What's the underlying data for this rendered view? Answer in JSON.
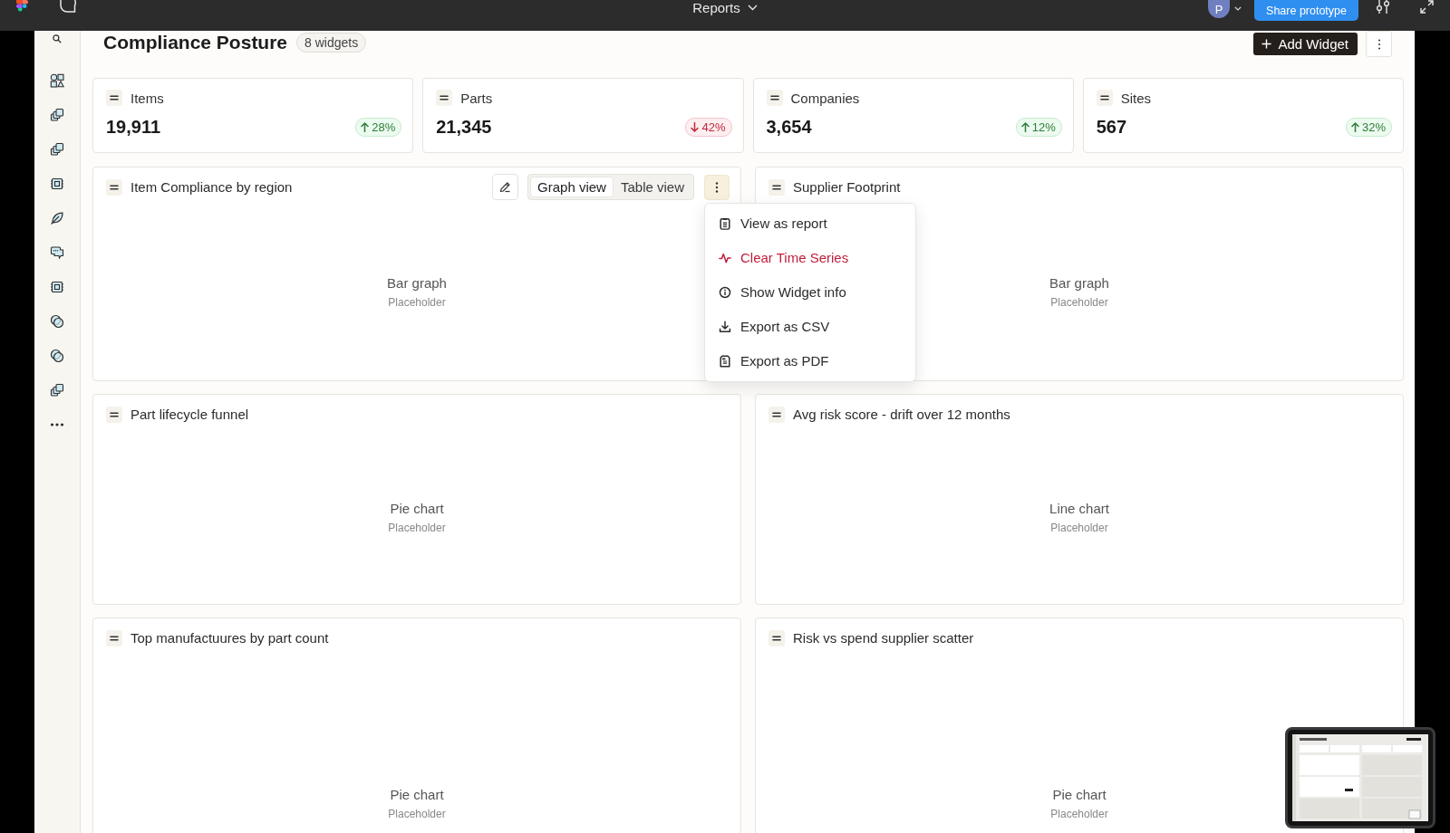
{
  "top_bar": {
    "title": "Reports",
    "avatar": "P",
    "share_button": "Share prototype"
  },
  "header": {
    "title": "Compliance Posture",
    "count": "8 widgets",
    "add_button": "Add Widget"
  },
  "stats": [
    {
      "label": "Items",
      "value": "19,911",
      "change": "28%",
      "rising": true
    },
    {
      "label": "Parts",
      "value": "21,345",
      "change": "42%",
      "rising": false
    },
    {
      "label": "Companies",
      "value": "3,654",
      "change": "12%",
      "rising": true
    },
    {
      "label": "Sites",
      "value": "567",
      "change": "32%",
      "rising": true
    }
  ],
  "widgets": [
    {
      "title": "Item Compliance by region",
      "chart_label": "Bar graph",
      "chart_note": "Placeholder",
      "toolbar": {
        "views": [
          {
            "label": "Graph view",
            "selected": true
          },
          {
            "label": "Table view",
            "selected": false
          }
        ],
        "menu_open": true,
        "menu": [
          {
            "label": "View as report",
            "danger": false
          },
          {
            "label": "Clear Time Series",
            "danger": true
          },
          {
            "label": "Show Widget info",
            "danger": false
          },
          {
            "label": "Export as CSV",
            "danger": false
          },
          {
            "label": "Export as PDF",
            "danger": false
          }
        ]
      }
    },
    {
      "title": "Supplier Footprint",
      "chart_label": "Bar graph",
      "chart_note": "Placeholder"
    },
    {
      "title": "Part lifecycle funnel",
      "chart_label": "Pie chart",
      "chart_note": "Placeholder"
    },
    {
      "title": "Avg risk score - drift over 12 months",
      "chart_label": "Line chart",
      "chart_note": "Placeholder"
    },
    {
      "title": "Top manufactuures by part count",
      "chart_label": "Pie chart",
      "chart_note": "Placeholder"
    },
    {
      "title": "Risk vs spend supplier scatter",
      "chart_label": "Pie chart",
      "chart_note": "Placeholder"
    }
  ]
}
